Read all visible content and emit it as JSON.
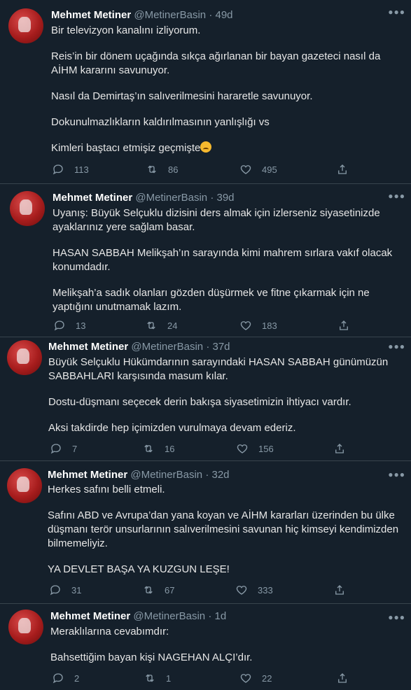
{
  "tweets": [
    {
      "name": "Mehmet Metiner",
      "handle": "@MetinerBasin",
      "time": "49d",
      "paragraphs": [
        "Bir televizyon kanalını izliyorum.",
        "Reis’in bir dönem uçağında sıkça ağırlanan bir bayan gazeteci nasıl da AİHM kararını savunuyor.",
        "Nasıl da Demirtaş’ın salıverilmesini hararetle savunuyor.",
        "Dokunulmazlıkların kaldırılmasının yanlışlığı vs",
        "Kimleri baştacı etmişiz geçmişte"
      ],
      "emoji": "disappointed-face",
      "replies": "113",
      "retweets": "86",
      "likes": "495"
    },
    {
      "name": "Mehmet Metiner",
      "handle": "@MetinerBasin",
      "time": "39d",
      "paragraphs": [
        "Uyanış: Büyük Selçuklu dizisini ders almak için izlerseniz siyasetinizde ayaklarınız yere sağlam basar.",
        "HASAN SABBAH Melikşah’ın sarayında kimi mahrem sırlara vakıf olacak konumdadır.",
        "Melikşah’a sadık olanları gözden düşürmek ve fitne çıkarmak için ne yaptığını unutmamak lazım."
      ],
      "replies": "13",
      "retweets": "24",
      "likes": "183"
    },
    {
      "name": "Mehmet Metiner",
      "handle": "@MetinerBasin",
      "time": "37d",
      "paragraphs": [
        "Büyük Selçuklu Hükümdarının sarayındaki HASAN SABBAH günümüzün SABBAHLARI karşısında masum kılar.",
        "Dostu-düşmanı seçecek derin bakışa siyasetimizin ihtiyacı vardır.",
        "Aksi takdirde hep içimizden vurulmaya devam ederiz."
      ],
      "replies": "7",
      "retweets": "16",
      "likes": "156"
    },
    {
      "name": "Mehmet Metiner",
      "handle": "@MetinerBasin",
      "time": "32d",
      "paragraphs": [
        "Herkes safını belli etmeli.",
        "Safını ABD ve Avrupa’dan yana koyan ve AİHM kararları üzerinden bu ülke düşmanı terör unsurlarının salıverilmesini savunan hiç kimseyi kendimizden bilmemeliyiz.",
        "YA DEVLET BAŞA YA KUZGUN LEŞE!"
      ],
      "replies": "31",
      "retweets": "67",
      "likes": "333"
    },
    {
      "name": "Mehmet Metiner",
      "handle": "@MetinerBasin",
      "time": "1d",
      "paragraphs": [
        "Meraklılarına cevabımdır:",
        "Bahsettiğim bayan kişi NAGEHAN ALÇI’dır."
      ],
      "replies": "2",
      "retweets": "1",
      "likes": "22"
    }
  ],
  "separator": "·",
  "icons": {
    "reply": "reply-icon",
    "retweet": "retweet-icon",
    "like": "heart-icon",
    "share": "share-icon",
    "more": "more-icon"
  },
  "colors": {
    "background": "#15202b",
    "border": "#38444d",
    "muted": "#8899a6",
    "text": "#e6e6e6"
  }
}
